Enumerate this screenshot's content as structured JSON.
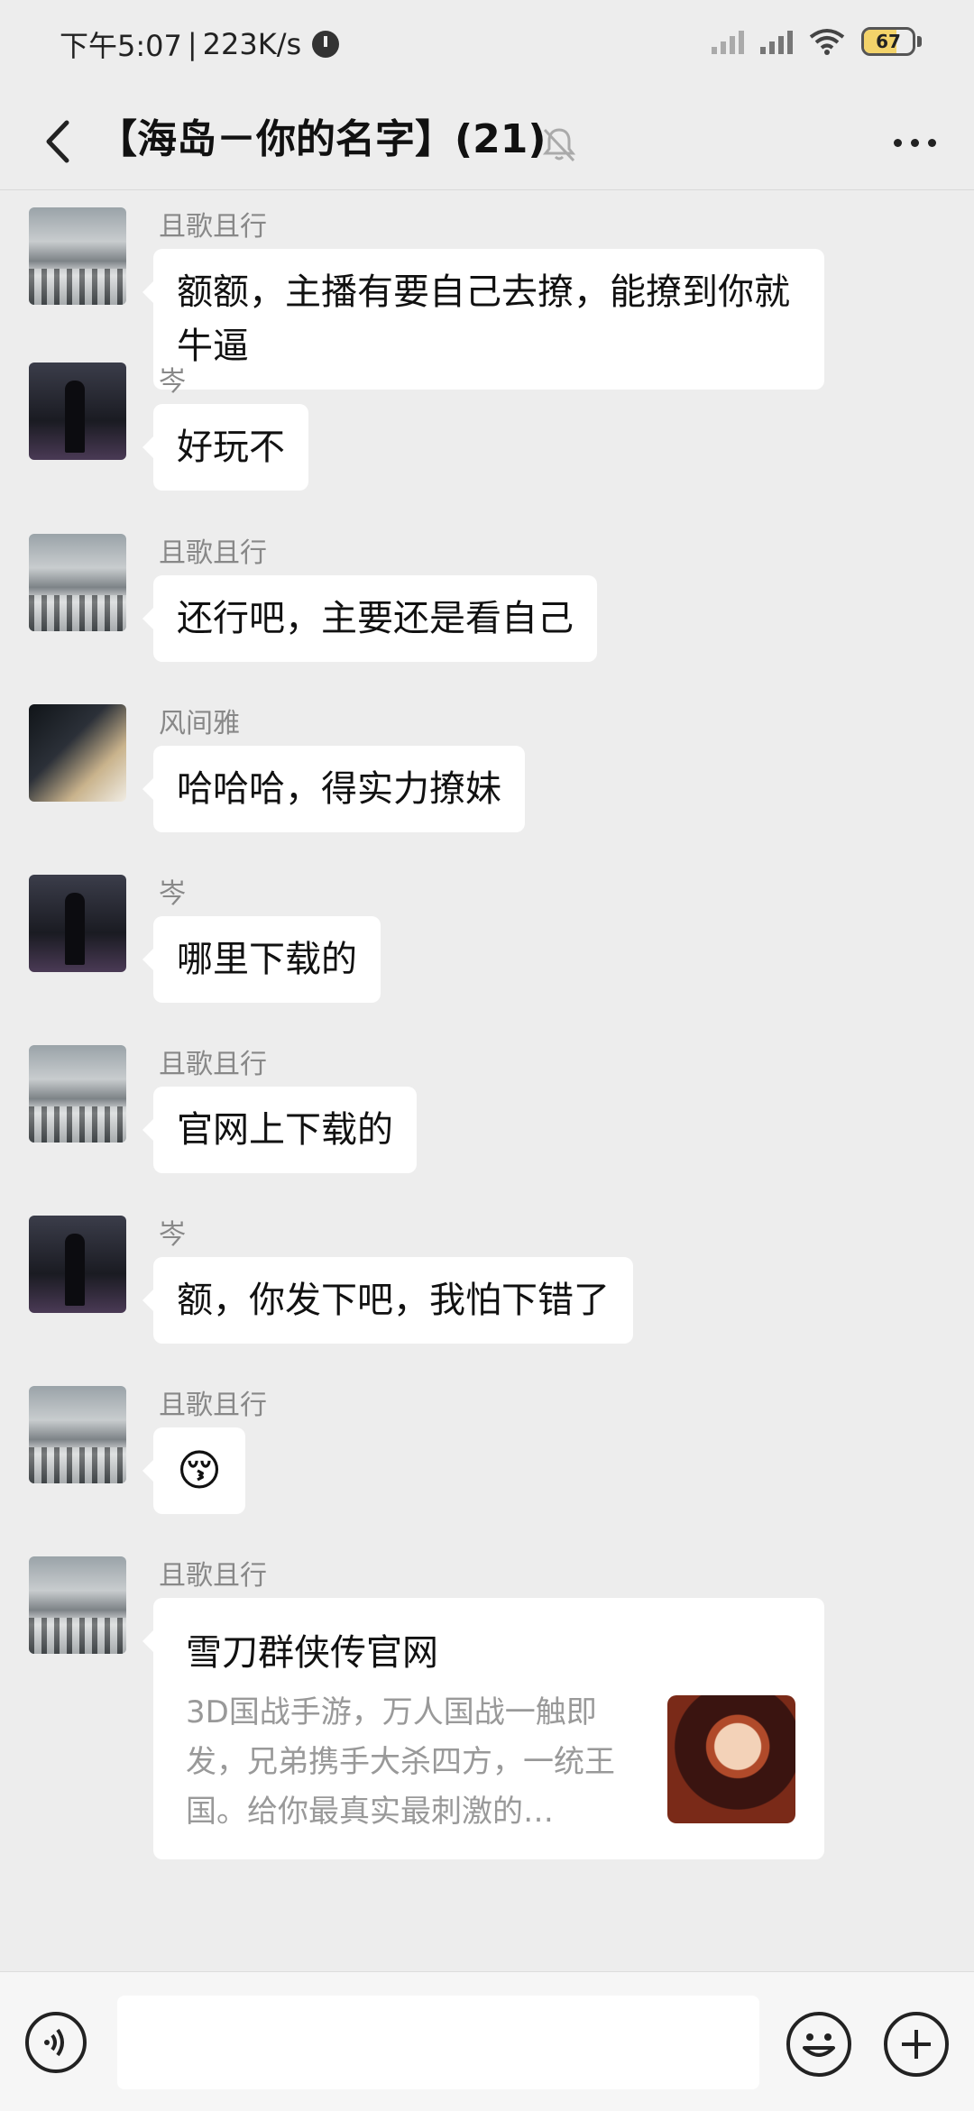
{
  "status_bar": {
    "time": "下午5:07",
    "net_speed": "223K/s",
    "battery": "67",
    "battery_fraction": 0.67
  },
  "header": {
    "title": "【海岛－你的名字】(21)",
    "back_icon": "chevron-left-icon",
    "mute_icon": "bell-off-icon",
    "more_icon": "more-dots-icon"
  },
  "messages": [
    {
      "sender": "且歌且行",
      "avatar": "snow-landscape",
      "text": "额额，主播有要自己去撩，能撩到你就牛逼"
    },
    {
      "sender": "岑",
      "avatar": "dark-railway",
      "text": "好玩不"
    },
    {
      "sender": "且歌且行",
      "avatar": "snow-landscape",
      "text": "还行吧，主要还是看自己"
    },
    {
      "sender": "风间雅",
      "avatar": "person-dining",
      "text": "哈哈哈，得实力撩妹"
    },
    {
      "sender": "岑",
      "avatar": "dark-railway",
      "text": "哪里下载的"
    },
    {
      "sender": "且歌且行",
      "avatar": "snow-landscape",
      "text": "官网上下载的"
    },
    {
      "sender": "岑",
      "avatar": "dark-railway",
      "text": "额，你发下吧，我怕下错了"
    },
    {
      "sender": "且歌且行",
      "avatar": "snow-landscape",
      "text": "😚"
    },
    {
      "sender": "且歌且行",
      "avatar": "snow-landscape",
      "card": {
        "title": "雪刀群侠传官网",
        "description": "3D国战手游，万人国战一触即发，兄弟携手大杀四方，一统王国。给你最真实最刺激的…"
      }
    }
  ],
  "input_bar": {
    "voice_icon": "voice-icon",
    "emoji_icon": "emoji-icon",
    "plus_icon": "plus-icon",
    "input_value": ""
  },
  "colors": {
    "background": "#ededed",
    "bubble": "#ffffff",
    "sender_name": "#888888"
  }
}
